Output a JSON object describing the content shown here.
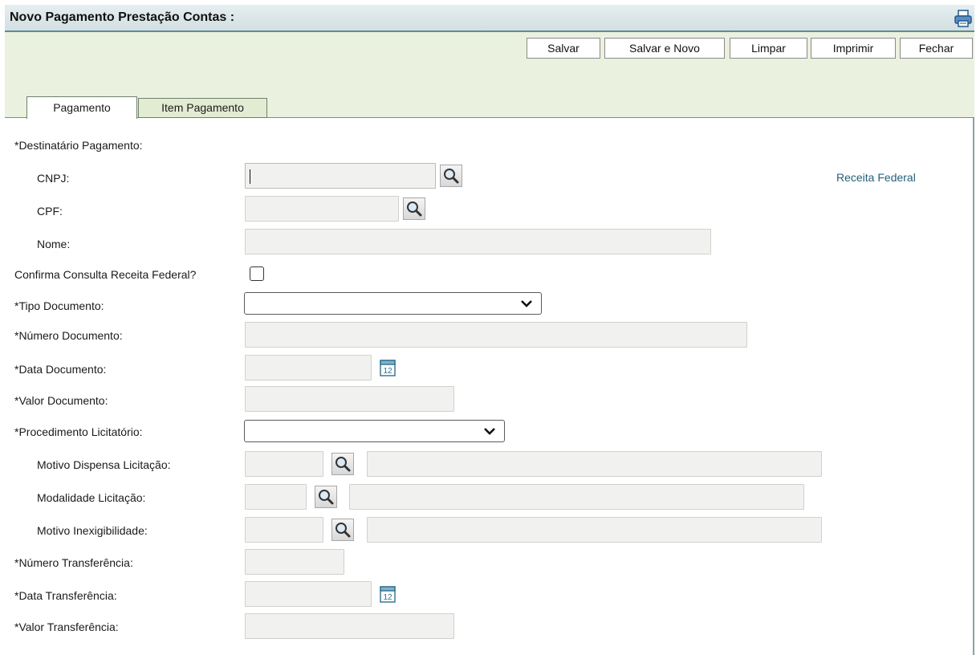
{
  "header": {
    "title": "Novo Pagamento Prestação Contas :",
    "print_icon": "printer-icon"
  },
  "toolbar": {
    "salvar": "Salvar",
    "salvar_novo": "Salvar e Novo",
    "limpar": "Limpar",
    "imprimir": "Imprimir",
    "fechar": "Fechar"
  },
  "tabs": [
    {
      "label": "Pagamento",
      "active": true
    },
    {
      "label": "Item Pagamento",
      "active": false
    }
  ],
  "form": {
    "destinatario_label": "*Destinatário Pagamento:",
    "cnpj_label": "CNPJ:",
    "cnpj_value": "",
    "cpf_label": "CPF:",
    "cpf_value": "",
    "nome_label": "Nome:",
    "nome_value": "",
    "receita_link": "Receita Federal",
    "confirma_label": "Confirma Consulta Receita Federal?",
    "confirma_checked": false,
    "tipo_doc_label": "*Tipo Documento:",
    "tipo_doc_value": "",
    "num_doc_label": "*Número Documento:",
    "num_doc_value": "",
    "data_doc_label": "*Data Documento:",
    "data_doc_value": "",
    "valor_doc_label": "*Valor Documento:",
    "valor_doc_value": "",
    "proc_lic_label": "*Procedimento Licitatório:",
    "proc_lic_value": "",
    "motivo_dispensa_label": "Motivo Dispensa Licitação:",
    "modalidade_label": "Modalidade Licitação:",
    "motivo_inex_label": "Motivo Inexigibilidade:",
    "num_transf_label": "*Número Transferência:",
    "num_transf_value": "",
    "data_transf_label": "*Data Transferência:",
    "data_transf_value": "",
    "valor_transf_label": "*Valor Transferência:",
    "valor_transf_value": ""
  },
  "icons": {
    "lookup": "magnifier-icon",
    "calendar": "calendar-icon",
    "calendar_day": "12",
    "dropdown": "chevron-down-icon"
  },
  "colors": {
    "header_bg": "#d3dfe2",
    "toolbar_bg": "#ebf1df",
    "field_bg": "#f1f2ef",
    "link": "#25607a"
  }
}
